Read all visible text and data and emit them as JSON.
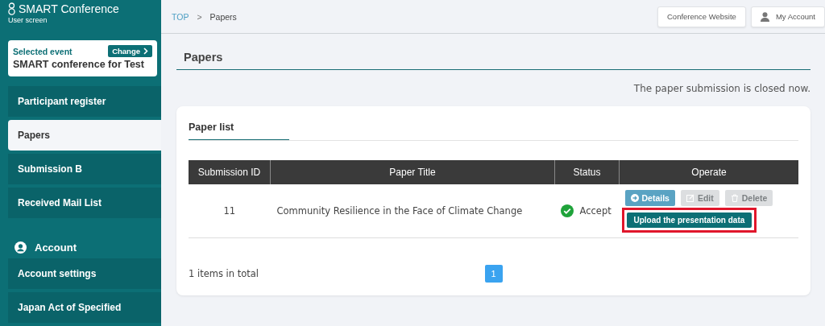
{
  "sidebar": {
    "logo": "SMART Conference",
    "subtitle": "User screen",
    "event": {
      "label": "Selected event",
      "change_button": "Change",
      "name": "SMART conference for Test"
    },
    "items": [
      {
        "label": "Participant register",
        "selected": false
      },
      {
        "label": "Papers",
        "selected": true
      },
      {
        "label": "Submission B",
        "selected": false
      },
      {
        "label": "Received Mail List",
        "selected": false
      }
    ],
    "account_section": {
      "title": "Account",
      "items": [
        {
          "label": "Account settings",
          "selected": false
        },
        {
          "label": "Japan Act of Specified",
          "selected": false
        }
      ]
    }
  },
  "breadcrumb": [
    {
      "label": "TOP",
      "link": true
    },
    {
      "label": ">",
      "kind": "separator"
    },
    {
      "label": "Papers",
      "link": false
    }
  ],
  "header_buttons": [
    {
      "label": "Conference Website",
      "kind": "plain"
    },
    {
      "label": "My Account",
      "kind": "user"
    }
  ],
  "page_title": "Papers",
  "notice": "The paper submission is closed now.",
  "card": {
    "title": "Paper list",
    "table": {
      "columns": [
        "Submission ID",
        "Paper Title",
        "Status",
        "Operate"
      ],
      "rows": [
        {
          "id": "11",
          "title": "Community Resilience in the Face of Climate Change",
          "status": "Accept",
          "actions": [
            {
              "label": "Details",
              "kind": "details",
              "disabled": false
            },
            {
              "label": "Edit",
              "kind": "edit",
              "disabled": true
            },
            {
              "label": "Delete",
              "kind": "delete",
              "disabled": true
            }
          ],
          "upload": {
            "label": "Upload the presentation data",
            "highlighted": true
          }
        }
      ]
    },
    "total": "1 items in total",
    "pages": [
      {
        "label": "1",
        "selected": true
      }
    ]
  }
}
